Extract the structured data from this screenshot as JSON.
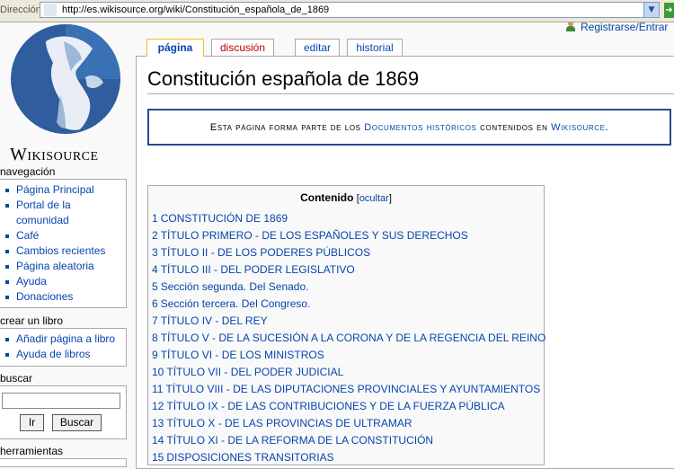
{
  "browser": {
    "address_label": "Dirección",
    "url": "http://es.wikisource.org/wiki/Constitución_española_de_1869"
  },
  "personal": {
    "login": "Registrarse/Entrar"
  },
  "tabs": {
    "page": "página",
    "discussion": "discusión",
    "edit": "editar",
    "history": "historial"
  },
  "site": {
    "name": "Wikisource"
  },
  "nav": {
    "title": "navegación",
    "items": [
      "Página Principal",
      "Portal de la comunidad",
      "Café",
      "Cambios recientes",
      "Página aleatoria",
      "Ayuda",
      "Donaciones"
    ]
  },
  "book": {
    "title": "crear un libro",
    "items": [
      "Añadir página a libro",
      "Ayuda de libros"
    ]
  },
  "search": {
    "title": "buscar",
    "go_label": "Ir",
    "search_label": "Buscar"
  },
  "tools": {
    "title": "herramientas"
  },
  "page": {
    "title": "Constitución española de 1869",
    "notice_pre": "Esta página forma parte de los ",
    "notice_link1": "Documentos históricos",
    "notice_mid": " contenidos en ",
    "notice_link2": "Wikisource",
    "notice_post": "."
  },
  "toc": {
    "title": "Contenido",
    "toggle": "ocultar",
    "items": [
      {
        "num": "1",
        "text": "CONSTITUCIÓN DE 1869"
      },
      {
        "num": "2",
        "text": "TÍTULO PRIMERO - DE LOS ESPAÑOLES Y SUS DERECHOS"
      },
      {
        "num": "3",
        "text": "TÍTULO II - DE LOS PODERES PÚBLICOS"
      },
      {
        "num": "4",
        "text": "TÍTULO III - DEL PODER LEGISLATIVO"
      },
      {
        "num": "5",
        "text": "Sección segunda. Del Senado."
      },
      {
        "num": "6",
        "text": "Sección tercera. Del Congreso."
      },
      {
        "num": "7",
        "text": "TÍTULO IV - DEL REY"
      },
      {
        "num": "8",
        "text": "TÍTULO V - DE LA SUCESIÓN A LA CORONA Y DE LA REGENCIA DEL REINO"
      },
      {
        "num": "9",
        "text": "TÍTULO VI - DE LOS MINISTROS"
      },
      {
        "num": "10",
        "text": "TÍTULO VII - DEL PODER JUDICIAL"
      },
      {
        "num": "11",
        "text": "TÍTULO VIII - DE LAS DIPUTACIONES PROVINCIALES Y AYUNTAMIENTOS"
      },
      {
        "num": "12",
        "text": "TÍTULO IX - DE LAS CONTRIBUCIONES Y DE LA FUERZA PÚBLICA"
      },
      {
        "num": "13",
        "text": "TÍTULO X - DE LAS PROVINCIAS DE ULTRAMAR"
      },
      {
        "num": "14",
        "text": "TÍTULO XI - DE LA REFORMA DE LA CONSTITUCIÓN"
      },
      {
        "num": "15",
        "text": "DISPOSICIONES TRANSITORIAS"
      }
    ]
  }
}
